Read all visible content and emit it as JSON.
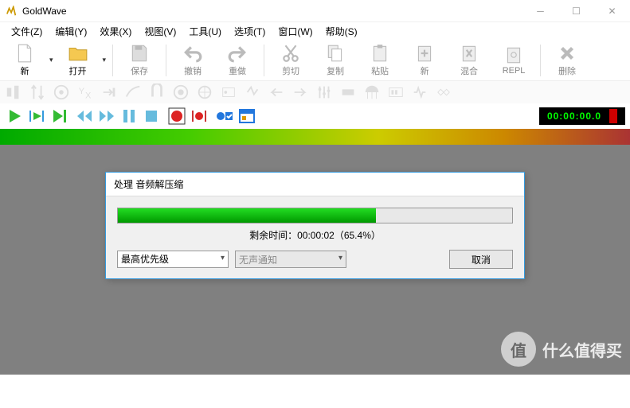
{
  "window": {
    "title": "GoldWave"
  },
  "menu": [
    "文件(Z)",
    "编辑(Y)",
    "效果(X)",
    "视图(V)",
    "工具(U)",
    "选项(T)",
    "窗口(W)",
    "帮助(S)"
  ],
  "toolbar": {
    "new": "新",
    "open": "打开",
    "save": "保存",
    "undo": "撤销",
    "redo": "重做",
    "cut": "剪切",
    "copy": "复制",
    "paste": "粘贴",
    "new2": "新",
    "mix": "混合",
    "repl": "REPL",
    "delete": "删除"
  },
  "timecode": "00:00:00.0",
  "dialog": {
    "title": "处理 音频解压缩",
    "remaining_label": "剩余时间：",
    "remaining_value": "00:00:02（65.4%）",
    "progress_pct": 65.4,
    "priority": "最高优先级",
    "notify": "无声通知",
    "cancel": "取消"
  },
  "watermark": {
    "badge": "值",
    "text": "什么值得买"
  }
}
